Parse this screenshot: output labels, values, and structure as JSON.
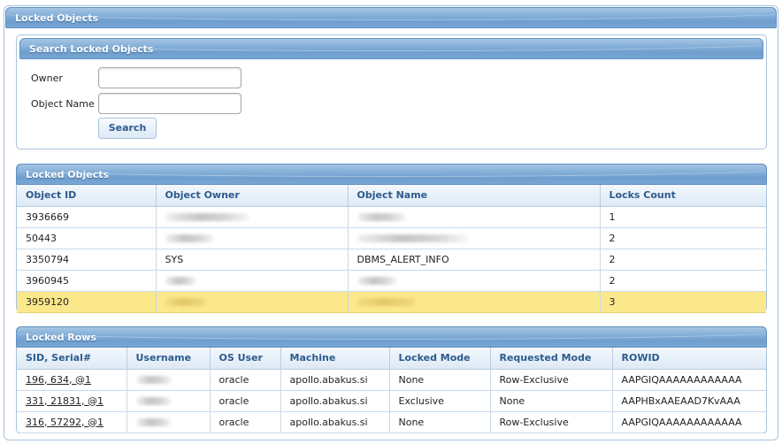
{
  "page": {
    "title": "Locked Objects"
  },
  "search": {
    "title": "Search Locked Objects",
    "owner_label": "Owner",
    "owner_value": "",
    "object_name_label": "Object Name",
    "object_name_value": "",
    "button_label": "Search"
  },
  "objects": {
    "title": "Locked Objects",
    "columns": [
      "Object ID",
      "Object Owner",
      "Object Name",
      "Locks Count"
    ],
    "rows": [
      {
        "id": "3936669",
        "owner": "",
        "owner_redacted": true,
        "name": "",
        "name_redacted": true,
        "count": "1",
        "selected": false
      },
      {
        "id": "50443",
        "owner": "",
        "owner_redacted": true,
        "name": "",
        "name_redacted": true,
        "count": "2",
        "selected": false
      },
      {
        "id": "3350794",
        "owner": "SYS",
        "owner_redacted": false,
        "name": "DBMS_ALERT_INFO",
        "name_redacted": false,
        "count": "2",
        "selected": false
      },
      {
        "id": "3960945",
        "owner": "",
        "owner_redacted": true,
        "name": "",
        "name_redacted": true,
        "count": "2",
        "selected": false
      },
      {
        "id": "3959120",
        "owner": "",
        "owner_redacted": true,
        "name": "",
        "name_redacted": true,
        "count": "3",
        "selected": true
      }
    ]
  },
  "rows_panel": {
    "title": "Locked Rows",
    "columns": [
      "SID, Serial#",
      "Username",
      "OS User",
      "Machine",
      "Locked Mode",
      "Requested Mode",
      "ROWID"
    ],
    "rows": [
      {
        "sid": "196, 634, @1",
        "username": "",
        "os_user": "oracle",
        "machine": "apollo.abakus.si",
        "locked_mode": "None",
        "requested_mode": "Row-Exclusive",
        "rowid": "AAPGIQAAAAAAAAAAAA"
      },
      {
        "sid": "331, 21831, @1",
        "username": "",
        "os_user": "oracle",
        "machine": "apollo.abakus.si",
        "locked_mode": "Exclusive",
        "requested_mode": "None",
        "rowid": "AAPHBxAAEAAD7KvAAA"
      },
      {
        "sid": "316, 57292, @1",
        "username": "",
        "os_user": "oracle",
        "machine": "apollo.abakus.si",
        "locked_mode": "None",
        "requested_mode": "Row-Exclusive",
        "rowid": "AAPGIQAAAAAAAAAAAA"
      }
    ]
  },
  "colors": {
    "header_blue": "#7aa7d4",
    "selected_row": "#fbe88b",
    "link_blue": "#2d5a8e"
  }
}
